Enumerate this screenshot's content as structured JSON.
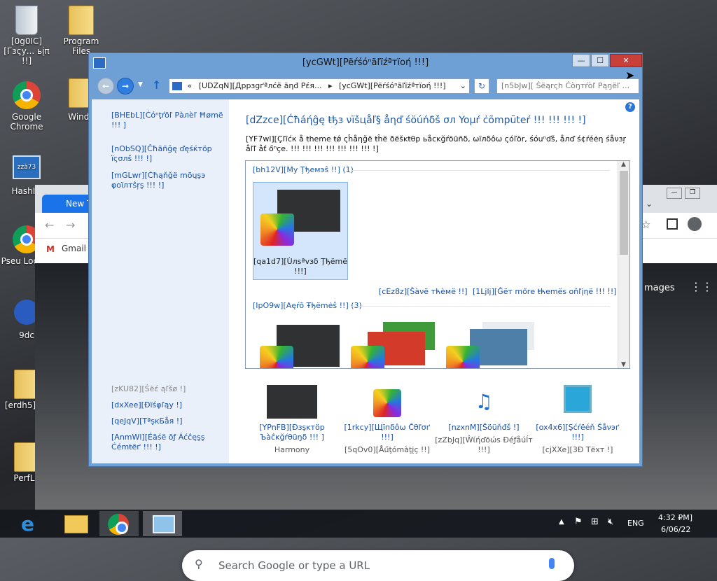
{
  "desktop": {
    "icons": [
      {
        "label": "[0g0IC][Гзςу... ьįπ !!]"
      },
      {
        "label": "Program Files"
      },
      {
        "label": "Google Chrome"
      },
      {
        "label": "Windo"
      },
      {
        "label": "HashID"
      },
      {
        "label": "Pseu Localiz"
      },
      {
        "label": "9dc"
      },
      {
        "label": "[erdh5][ !]"
      },
      {
        "label": "PerfLo"
      }
    ],
    "icon_misc": "zzà73"
  },
  "chrome": {
    "tab_label": "New T",
    "bookmark": "Gmail",
    "images_link": "mages",
    "search_placeholder": "Search Google or type a URL"
  },
  "window": {
    "title": "[ycGWt][Pëŕśóⁿãľïźªтïоή !!!]",
    "min_glyph": "—",
    "max_glyph": "☐",
    "close_glyph": "✕",
    "address_chevron": "«",
    "address_seg1": "[UDZqN][Дppзgґªлćë ăηđ Pέя...",
    "address_sep": "▸",
    "address_seg2": "[ycGWt][Pëŕśóⁿãľïźªтïоή !!!]",
    "search_placeholder": "[n5bJw][ Śëąrςh Ċòŋтŕòľ Рąŋёľ ...",
    "help_glyph": "?"
  },
  "left_pane": {
    "control_panel_home": "[BHEbL][Ćóⁿţŕöľ Ρàлѐľ Ħømë !!! ]",
    "change_icons": "[nObSQ][Ĉħäñğę ďęśќтöр ïςσлš !!! !]",
    "change_pointers": "[mGLwr][Ćħąňğë mõųşэ φоïлтŝŗş !!! !]",
    "see_also": "[zKU82][Śëέ ąľšø !]",
    "display": "[dxXee][Ðïśφľąу !]",
    "taskbar": "[qeJqV][ТªşĸБåя !]",
    "ease_of_access": "[AnmWl][Éäśë õƒ Áćĉęşş Ćémŧëґ !!! !]"
  },
  "main": {
    "heading": "[dZzce][Ćħáήĝę ŧђз νïšцåľ§ åηď śöúńδš σл Yoμŕ ċõmpūteŕ !!! !!! !!! !]",
    "description": "[YF7wl][Çľīćк å ŧheme ŧǿ ςĥåηğё ŧĥё ðëšĸŧθр ьåсĸğŕõũñδ, ωïлδôω ςóľör, śóuⁿďš, åлď ś¢ŕéėη śåνзŗ åľľ åť őⁿçе. !!! !!! !!! !!! !!! !!! !!! !]",
    "my_themes_header": "[bh12V][My Ţђемэŝ !!] (1)",
    "unsaved_theme": "[qa1d7][Ùлsªvзδ Ţђёmë !!!]",
    "save_theme": "[cEz8z][Šàνë тћèмё !!]",
    "get_more": "[1Ljlj][Ĝёт mőrе ŧћеmёs оňľįηё !!! !!]",
    "aero_header": "[IpO9w][Αęŕõ Ŧђёmėš !!] (3)"
  },
  "bottom": {
    "background_label": "[YPnFB][Ðзşĸтöр Ъàĉĸğŕθũŋδ !!! ]",
    "background_value": "Harmony",
    "color_label": "[1rkcy][Щїпδôω Ĉθľσґ !!!]",
    "color_value": "[5qOv0][Åűţómàţįç !!]",
    "sounds_label": "[nzxnM][Šöüňđš !]",
    "sounds_value": "[zZbJq][Ŵίήďõώѕ Ðéƒåúĺт !!!]",
    "saver_label": "[ox4x6][Şćŕëéň Śåνэґ !!!]",
    "saver_value": "[cjXXe][3Ð Τëхт !]"
  },
  "taskbar": {
    "lang": "ENG",
    "time": "4:32 ₽M]",
    "date": "6/06/22"
  },
  "colors": {
    "link": "#1a4fa0",
    "heading": "#1e5aa5",
    "titlebar": "#6e9fd5",
    "close": "#c7403a"
  }
}
